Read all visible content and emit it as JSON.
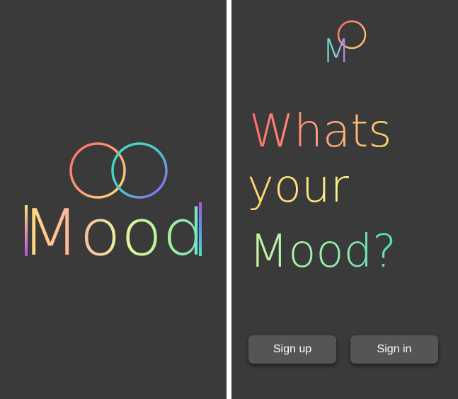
{
  "splash": {
    "logo_text": "Mood"
  },
  "welcome": {
    "logo_letter": "M",
    "headline_line1": "Whats",
    "headline_line2": "your",
    "headline_line3": "Mood?",
    "signup_label": "Sign up",
    "signin_label": "Sign in"
  },
  "colors": {
    "background": "#3a3a3a",
    "button": "#555555",
    "gradient": [
      "#ff6b6b",
      "#ffd36e",
      "#fff48a",
      "#a6f29c",
      "#4ee0c0",
      "#8b6cf2",
      "#d94fd9"
    ]
  }
}
